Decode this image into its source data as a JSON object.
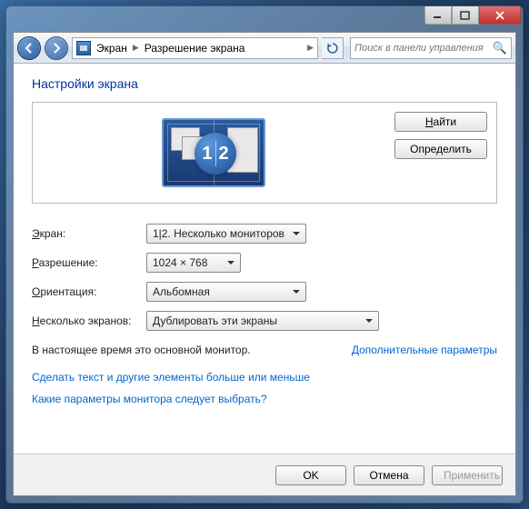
{
  "breadcrumb": {
    "item1": "Экран",
    "item2": "Разрешение экрана"
  },
  "search": {
    "placeholder": "Поиск в панели управления"
  },
  "heading": "Настройки экрана",
  "buttons": {
    "find": "Найти",
    "identify": "Определить",
    "ok": "OK",
    "cancel": "Отмена",
    "apply": "Применить"
  },
  "labels": {
    "screen": "Экран:",
    "resolution": "Разрешение:",
    "orientation": "Ориентация:",
    "multiple": "Несколько экранов:"
  },
  "values": {
    "screen": "1|2. Несколько мониторов",
    "resolution": "1024 × 768",
    "orientation": "Альбомная",
    "multiple": "Дублировать эти экраны"
  },
  "status": "В настоящее время это основной монитор.",
  "adv_link": "Дополнительные параметры",
  "link1": "Сделать текст и другие элементы больше или меньше",
  "link2": "Какие параметры монитора следует выбрать?",
  "monitor_nums": {
    "a": "1",
    "b": "2"
  }
}
